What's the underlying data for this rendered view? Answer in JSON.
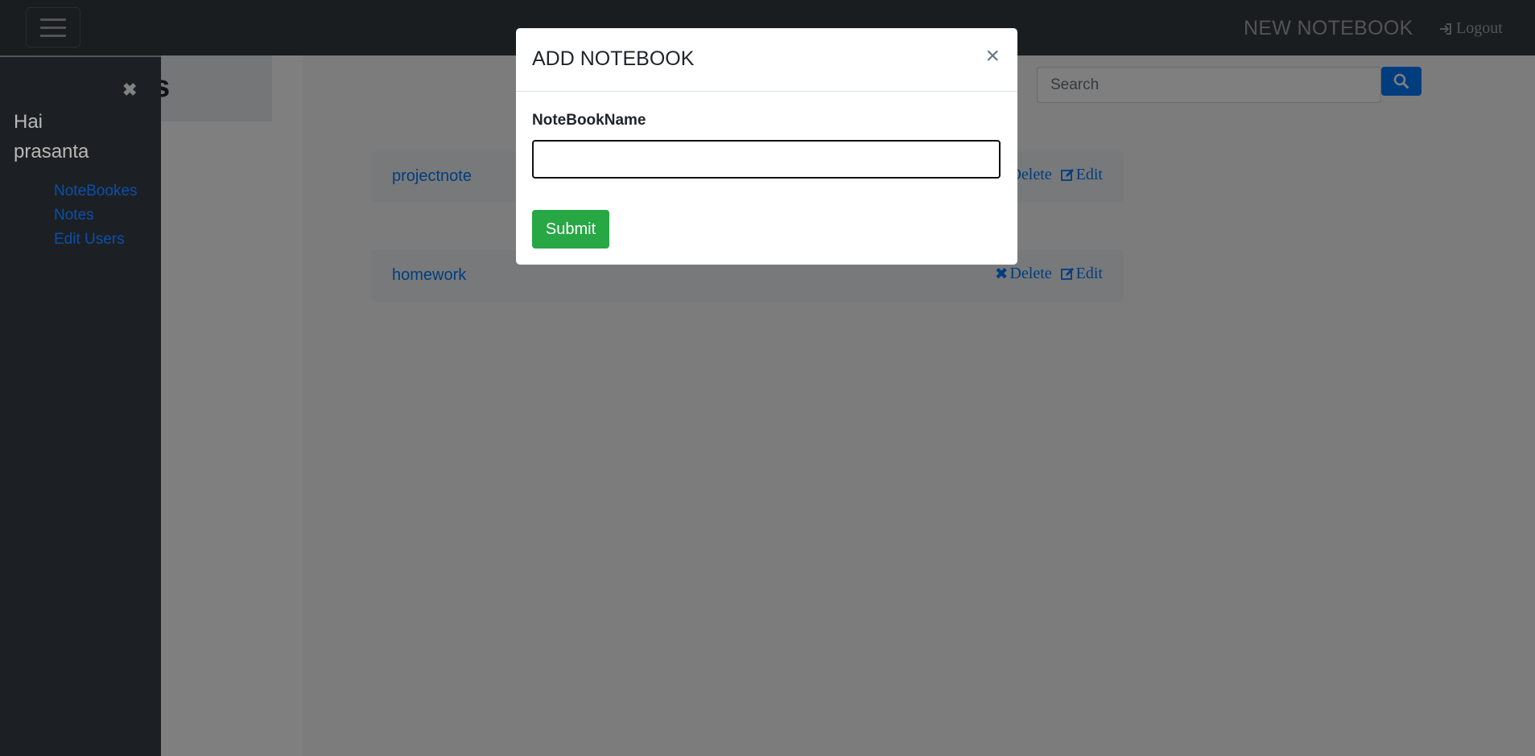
{
  "navbar": {
    "brand": "NEW NOTEBOOK",
    "logout_label": "Logout"
  },
  "page": {
    "heading_fragment": "s",
    "search_placeholder": "Search",
    "notebooks": [
      {
        "name": "projectnote",
        "delete_label": "Delete",
        "edit_label": "Edit"
      },
      {
        "name": "homework",
        "delete_label": "Delete",
        "edit_label": "Edit"
      }
    ]
  },
  "sidebar": {
    "greeting_line1": "Hai",
    "greeting_line2": "prasanta",
    "links": [
      "NoteBookes",
      "Notes",
      "Edit Users"
    ]
  },
  "modal": {
    "title": "ADD NOTEBOOK",
    "close_glyph": "×",
    "field_label": "NoteBookName",
    "field_value": "",
    "submit_label": "Submit"
  },
  "colors": {
    "navbar": "#343a40",
    "primary": "#007bff",
    "success": "#28a745",
    "sidebar": "#1c2024"
  }
}
